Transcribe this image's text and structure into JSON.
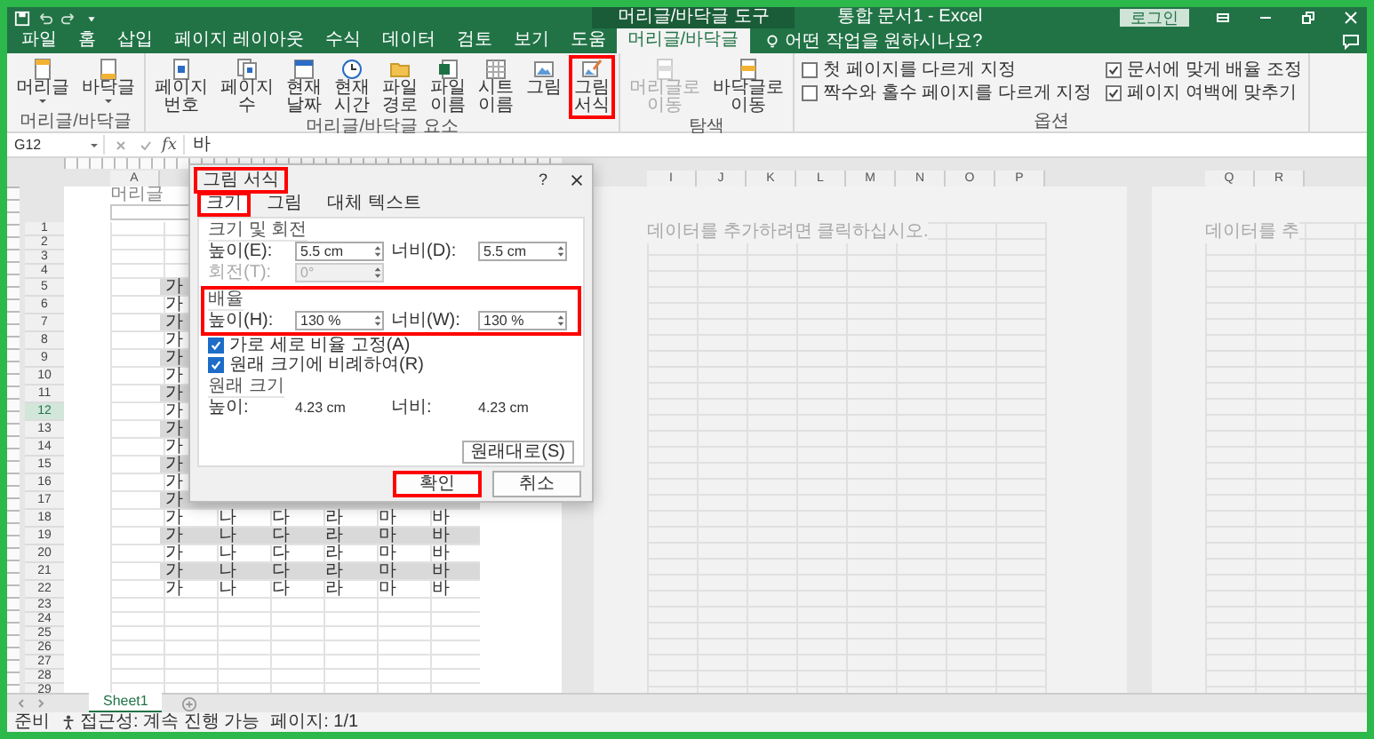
{
  "title_bar": {
    "context_label": "머리글/바닥글 도구",
    "title": "통합 문서1 - Excel",
    "sign_in": "로그인"
  },
  "tabs": [
    {
      "label": "파일",
      "selected": false
    },
    {
      "label": "홈",
      "selected": false
    },
    {
      "label": "삽입",
      "selected": false
    },
    {
      "label": "페이지 레이아웃",
      "selected": false
    },
    {
      "label": "수식",
      "selected": false
    },
    {
      "label": "데이터",
      "selected": false
    },
    {
      "label": "검토",
      "selected": false
    },
    {
      "label": "보기",
      "selected": false
    },
    {
      "label": "도움",
      "selected": false
    },
    {
      "label": "머리글/바닥글",
      "selected": true
    }
  ],
  "tell_me": {
    "placeholder": "어떤 작업을 원하시나요?"
  },
  "ribbon": {
    "groups": [
      {
        "label": "머리글/바닥글",
        "kind": "buttons",
        "buttons": [
          {
            "label": "머리글",
            "kind": "header",
            "dropdown": true
          },
          {
            "label": "바닥글",
            "kind": "footer",
            "dropdown": true
          }
        ]
      },
      {
        "label": "머리글/바닥글 요소",
        "kind": "buttons",
        "buttons": [
          {
            "label": "페이지 번호",
            "kind": "number",
            "highlighted": false
          },
          {
            "label": "페이지 수",
            "kind": "pages",
            "highlighted": false
          },
          {
            "label": "현재 날짜",
            "kind": "calendar",
            "highlighted": false
          },
          {
            "label": "현재 시간",
            "kind": "clock",
            "highlighted": false
          },
          {
            "label": "파일 경로",
            "kind": "folder",
            "highlighted": false
          },
          {
            "label": "파일 이름",
            "kind": "excel",
            "highlighted": false
          },
          {
            "label": "시트 이름",
            "kind": "sheet",
            "highlighted": false
          },
          {
            "label": "그림",
            "kind": "picture",
            "highlighted": false
          },
          {
            "label": "그림 서식",
            "kind": "format",
            "highlighted": true
          }
        ]
      },
      {
        "label": "탐색",
        "kind": "buttons",
        "buttons": [
          {
            "label": "머리글로 이동",
            "kind": "nav",
            "disabled": true
          },
          {
            "label": "바닥글로 이동",
            "kind": "nav",
            "disabled": false
          }
        ]
      },
      {
        "label": "옵션",
        "kind": "options",
        "options": [
          {
            "label": "첫 페이지를 다르게 지정",
            "checked": false
          },
          {
            "label": "짝수와 홀수 페이지를 다르게 지정",
            "checked": false
          },
          {
            "label": "문서에 맞게 배율 조정",
            "checked": true
          },
          {
            "label": "페이지 여백에 맞추기",
            "checked": true
          }
        ]
      }
    ]
  },
  "formula_bar": {
    "name_box": "G12",
    "function_label": "fx",
    "value": "바"
  },
  "sheet": {
    "columns_page1": [
      "A"
    ],
    "columns_page2": [
      "I",
      "J",
      "K",
      "L",
      "M",
      "N",
      "O",
      "P"
    ],
    "columns_page3": [
      "Q",
      "R"
    ],
    "header_label": "머리글",
    "page2_placeholder": "데이터를 추가하려면 클릭하십시오.",
    "page3_placeholder": "데이터를 추",
    "rows": [
      {
        "number": "1",
        "selected": false,
        "shaded": false
      },
      {
        "number": "2",
        "selected": false,
        "shaded": false
      },
      {
        "number": "3",
        "selected": false,
        "shaded": false
      },
      {
        "number": "4",
        "selected": false,
        "shaded": false
      },
      {
        "number": "5",
        "selected": false,
        "shaded": true,
        "cells": [
          "가"
        ]
      },
      {
        "number": "6",
        "selected": false,
        "shaded": false,
        "cells": [
          "가"
        ]
      },
      {
        "number": "7",
        "selected": false,
        "shaded": true,
        "cells": [
          "가"
        ]
      },
      {
        "number": "8",
        "selected": false,
        "shaded": false,
        "cells": [
          "가"
        ]
      },
      {
        "number": "9",
        "selected": false,
        "shaded": true,
        "cells": [
          "가"
        ]
      },
      {
        "number": "10",
        "selected": false,
        "shaded": false,
        "cells": [
          "가"
        ]
      },
      {
        "number": "11",
        "selected": false,
        "shaded": true,
        "cells": [
          "가"
        ]
      },
      {
        "number": "12",
        "selected": true,
        "shaded": false,
        "cells": [
          "가"
        ]
      },
      {
        "number": "13",
        "selected": false,
        "shaded": true,
        "cells": [
          "가"
        ]
      },
      {
        "number": "14",
        "selected": false,
        "shaded": false,
        "cells": [
          "가"
        ]
      },
      {
        "number": "15",
        "selected": false,
        "shaded": true,
        "cells": [
          "가"
        ]
      },
      {
        "number": "16",
        "selected": false,
        "shaded": false,
        "cells": [
          "가"
        ]
      },
      {
        "number": "17",
        "selected": false,
        "shaded": true,
        "cells": [
          "가"
        ]
      },
      {
        "number": "18",
        "selected": false,
        "shaded": false,
        "cells": [
          "가",
          "나",
          "다",
          "라",
          "마",
          "바"
        ]
      },
      {
        "number": "19",
        "selected": false,
        "shaded": true,
        "cells": [
          "가",
          "나",
          "다",
          "라",
          "마",
          "바"
        ]
      },
      {
        "number": "20",
        "selected": false,
        "shaded": false,
        "cells": [
          "가",
          "나",
          "다",
          "라",
          "마",
          "바"
        ]
      },
      {
        "number": "21",
        "selected": false,
        "shaded": true,
        "cells": [
          "가",
          "나",
          "다",
          "라",
          "마",
          "바"
        ]
      },
      {
        "number": "22",
        "selected": false,
        "shaded": false,
        "cells": [
          "가",
          "나",
          "다",
          "라",
          "마",
          "바"
        ]
      },
      {
        "number": "23",
        "selected": false,
        "shaded": false
      },
      {
        "number": "24",
        "selected": false,
        "shaded": false
      },
      {
        "number": "25",
        "selected": false,
        "shaded": false
      },
      {
        "number": "26",
        "selected": false,
        "shaded": false
      },
      {
        "number": "27",
        "selected": false,
        "shaded": false
      },
      {
        "number": "28",
        "selected": false,
        "shaded": false
      },
      {
        "number": "29",
        "selected": false,
        "shaded": false
      }
    ]
  },
  "dialog": {
    "title": "그림 서식",
    "title_highlighted": true,
    "help": "?",
    "tabs": [
      {
        "label": "크기",
        "selected": true,
        "highlighted": true
      },
      {
        "label": "그림",
        "selected": false,
        "highlighted": false
      },
      {
        "label": "대체 텍스트",
        "selected": false,
        "highlighted": false
      }
    ],
    "sections": [
      {
        "title": "크기 및 회전",
        "highlighted": false,
        "fields": [
          {
            "label": "높이(E):",
            "value": "5.5 cm",
            "disabled": false
          },
          {
            "label": "너비(D):",
            "value": "5.5 cm",
            "disabled": false
          },
          {
            "label": "회전(T):",
            "value": "0°",
            "disabled": true
          }
        ]
      },
      {
        "title": "배율",
        "highlighted": true,
        "fields": [
          {
            "label": "높이(H):",
            "value": "130 %",
            "disabled": false
          },
          {
            "label": "너비(W):",
            "value": "130 %",
            "disabled": false
          }
        ],
        "checkboxes": [
          {
            "label": "가로 세로 비율 고정(A)",
            "checked": true
          },
          {
            "label": "원래 크기에 비례하여(R)",
            "checked": true
          }
        ]
      },
      {
        "title": "원래 크기",
        "highlighted": false,
        "readouts": [
          {
            "label": "높이:",
            "value": "4.23 cm"
          },
          {
            "label": "너비:",
            "value": "4.23 cm"
          }
        ]
      }
    ],
    "reset_button": "원래대로(S)",
    "buttons": [
      {
        "label": "확인",
        "kind": "primary",
        "highlighted": true
      },
      {
        "label": "취소",
        "kind": "secondary",
        "highlighted": false
      }
    ]
  },
  "sheet_tabs": [
    {
      "label": "Sheet1",
      "selected": true
    }
  ],
  "status_bar": {
    "mode": "준비",
    "accessibility": "접근성: 계속 진행 가능",
    "page": "페이지: 1/1"
  }
}
